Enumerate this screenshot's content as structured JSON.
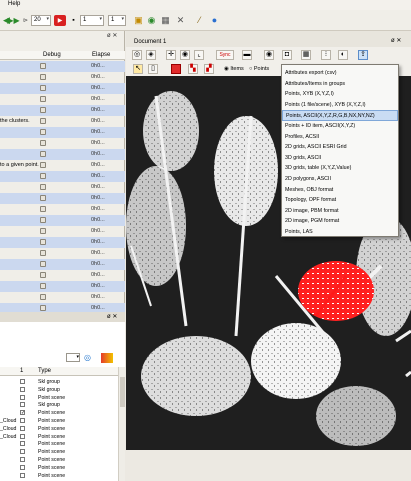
{
  "menubar": {
    "help_label": "Help"
  },
  "toolbar": {
    "spin_frame_value": "20",
    "spin_a_value": "1",
    "spin_b_value": "1"
  },
  "left_panel": {
    "columns": {
      "debug": "Debug",
      "elapsed": "Elapse"
    },
    "rows": [
      {
        "text": "",
        "num": "0h0..."
      },
      {
        "text": "",
        "num": "0h0..."
      },
      {
        "text": "",
        "num": "0h0..."
      },
      {
        "text": "",
        "num": "0h0..."
      },
      {
        "text": "",
        "num": "0h0..."
      },
      {
        "text": "the clusters.",
        "num": "0h0..."
      },
      {
        "text": "",
        "num": "0h0..."
      },
      {
        "text": "",
        "num": "0h0..."
      },
      {
        "text": "",
        "num": "0h0..."
      },
      {
        "text": "to a given point.",
        "num": "0h0..."
      },
      {
        "text": "",
        "num": "0h0..."
      },
      {
        "text": "",
        "num": "0h0..."
      },
      {
        "text": "",
        "num": "0h0..."
      },
      {
        "text": "",
        "num": "0h0..."
      },
      {
        "text": "",
        "num": "0h0..."
      },
      {
        "text": "",
        "num": "0h0..."
      },
      {
        "text": "",
        "num": "0h0..."
      },
      {
        "text": "",
        "num": "0h0..."
      },
      {
        "text": "",
        "num": "0h0..."
      },
      {
        "text": "",
        "num": "0h0..."
      },
      {
        "text": "",
        "num": "0h0..."
      },
      {
        "text": "",
        "num": "0h0..."
      },
      {
        "text": "",
        "num": "0h0..."
      }
    ],
    "lower": {
      "col_i": "1",
      "col_type": "Type",
      "rows": [
        {
          "name": "",
          "checked": false,
          "type": "Skl group"
        },
        {
          "name": "",
          "checked": false,
          "type": "Skl group"
        },
        {
          "name": "",
          "checked": false,
          "type": "Point scene"
        },
        {
          "name": "",
          "checked": false,
          "type": "Skl group"
        },
        {
          "name": "",
          "checked": true,
          "type": "Point scene"
        },
        {
          "name": "_Cloud",
          "checked": false,
          "type": "Point scene"
        },
        {
          "name": "_Cloud",
          "checked": false,
          "type": "Point scene"
        },
        {
          "name": "_Cloud",
          "checked": false,
          "type": "Point scene"
        },
        {
          "name": "",
          "checked": false,
          "type": "Point scene"
        },
        {
          "name": "",
          "checked": false,
          "type": "Point scene"
        },
        {
          "name": "",
          "checked": false,
          "type": "Point scene"
        },
        {
          "name": "",
          "checked": false,
          "type": "Point scene"
        },
        {
          "name": "",
          "checked": false,
          "type": "Point scene"
        }
      ]
    }
  },
  "view": {
    "doc_title": "Document 1",
    "items_label": "Items",
    "points_label": "Points"
  },
  "export_menu": {
    "items": [
      "Attributes export (csv)",
      "Attributes/Items in groups",
      "Points, XYB (X,Y,Z,I)",
      "Points (1 file/scene), XYB (X,Y,Z,I)",
      "Points, ASCII(X,Y,Z,R,G,B,NX,NY,NZ)",
      "Points + ID item, ASCII(X,Y,Z)",
      "Profiles, ACSII",
      "2D grids, ASCII ESRI Grid",
      "3D grids, ASCII",
      "3D grids, table (X,Y,Z,Value)",
      "2D polygons, ASCII",
      "Meshes, OBJ format",
      "Topology, OPF format",
      "2D image, PBM format",
      "2D image, PGM format",
      "Points, LAS"
    ],
    "selected_index": 4
  },
  "colors": {
    "accent_blue": "#cbd8ef",
    "menu_highlight": "#c9dcf3",
    "viewport_bg": "#1f1f1f",
    "highlight_red": "#e01010"
  }
}
